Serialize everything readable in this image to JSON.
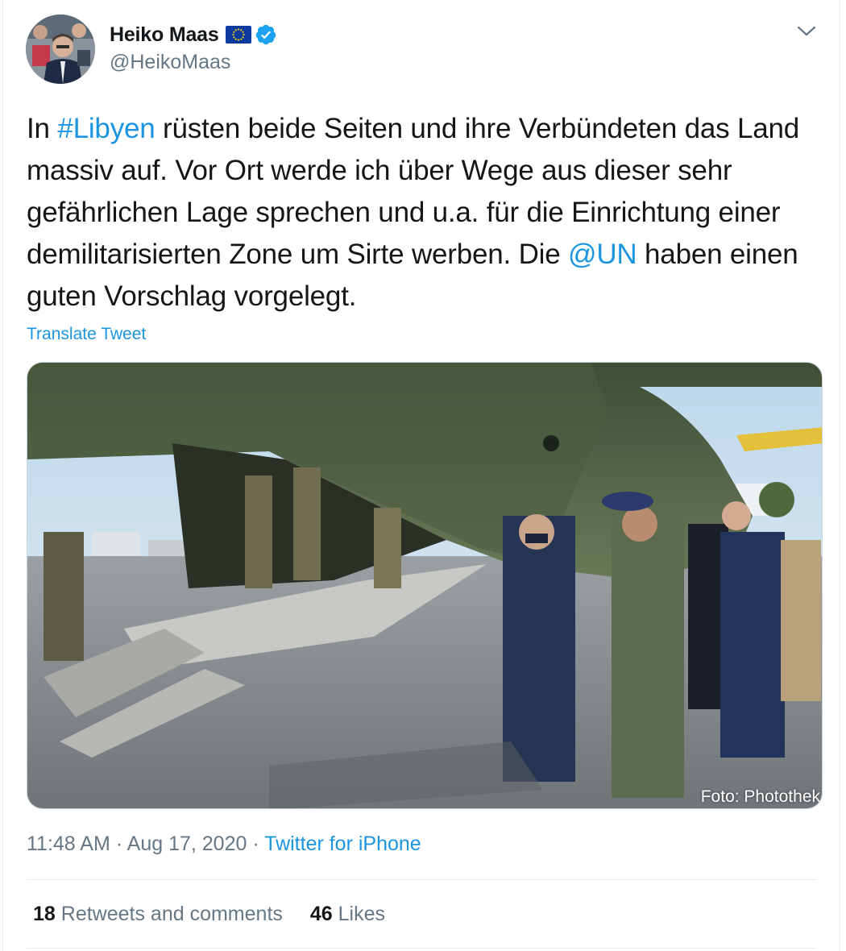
{
  "author": {
    "display_name": "Heiko Maas",
    "handle": "@HeikoMaas",
    "badge_icon": "eu-flag-icon",
    "verified_icon": "verified-badge-icon"
  },
  "tweet": {
    "text_parts": [
      "In ",
      "#Libyen",
      " rüsten beide Seiten und ihre Verbündeten das Land massiv auf. Vor Ort werde ich über Wege aus dieser sehr gefährlichen Lage sprechen und u.a. für die Einrichtung einer demilitarisierten Zone um Sirte werben. Die ",
      "@UN",
      " haben einen guten Vorschlag vorgelegt."
    ],
    "translate_label": "Translate Tweet",
    "photo_credit": "Foto: Photothek"
  },
  "meta": {
    "time": "11:48 AM",
    "separator": "·",
    "date": "Aug 17, 2020",
    "source": "Twitter for iPhone"
  },
  "stats": {
    "retweets_count": "18",
    "retweets_label": "Retweets and comments",
    "likes_count": "46",
    "likes_label": "Likes"
  },
  "colors": {
    "link": "#1b95e0",
    "secondary_text": "#657786",
    "primary_text": "#14171a"
  }
}
